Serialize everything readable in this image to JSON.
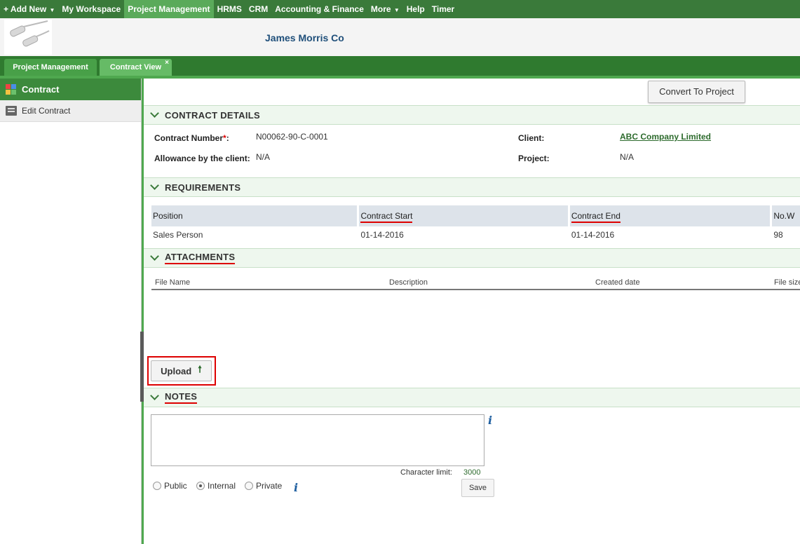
{
  "topnav": {
    "items": [
      "+ Add New",
      "My Workspace",
      "Project Management",
      "HRMS",
      "CRM",
      "Accounting & Finance",
      "More",
      "Help",
      "Timer"
    ],
    "active": "Project Management"
  },
  "header": {
    "company": "James Morris Co"
  },
  "tabs": [
    {
      "label": "Project Management"
    },
    {
      "label": "Contract View",
      "close": "×"
    }
  ],
  "sidebar": {
    "title": "Contract",
    "items": [
      {
        "label": "Edit Contract"
      }
    ]
  },
  "toolbar": {
    "convert_label": "Convert To Project"
  },
  "contract_details": {
    "heading": "CONTRACT DETAILS",
    "contract_number_label": "Contract Number",
    "required_mark": "*",
    "colon": ":",
    "contract_number": "N00062-90-C-0001",
    "client_label": "Client:",
    "client": "ABC Company Limited",
    "allowance_label": "Allowance by the client:",
    "allowance": "N/A",
    "project_label": "Project:",
    "project": "N/A"
  },
  "requirements": {
    "heading": "REQUIREMENTS",
    "columns": [
      "Position",
      "Contract Start",
      "Contract End",
      "No.W"
    ],
    "rows": [
      [
        "Sales Person",
        "01-14-2016",
        "01-14-2016",
        "98"
      ]
    ]
  },
  "attachments": {
    "heading": "ATTACHMENTS",
    "columns": [
      "File Name",
      "Description",
      "Created date",
      "File size"
    ],
    "upload_label": "Upload"
  },
  "notes": {
    "heading": "NOTES",
    "text": "",
    "char_limit_label": "Character limit:",
    "char_limit": "3000",
    "visibility_options": [
      "Public",
      "Internal",
      "Private"
    ],
    "selected_visibility": "Internal",
    "save_label": "Save"
  },
  "colors": {
    "nav_green": "#3a7a3a",
    "active_nav": "#5aaa5a",
    "section_bg": "#eef7ee",
    "highlight_red": "#dd0000",
    "company_blue": "#1f4f7a"
  }
}
